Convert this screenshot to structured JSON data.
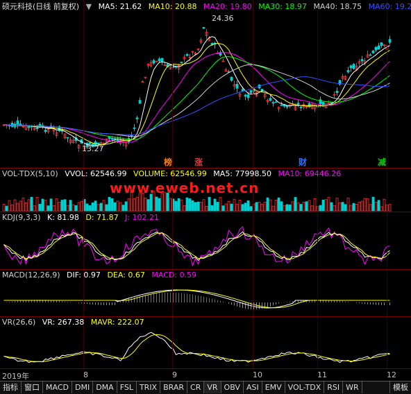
{
  "header": {
    "title": "硕元科技(日线 前复权)",
    "ma": [
      {
        "label": "MA5: 21.62",
        "color": "#ffffff"
      },
      {
        "label": "MA10: 20.88",
        "color": "#ffff00"
      },
      {
        "label": "MA20: 19.80",
        "color": "#ff00ff"
      },
      {
        "label": "MA30: 18.97",
        "color": "#00ff00"
      },
      {
        "label": "MA40: 18.75",
        "color": "#d0d0d0"
      },
      {
        "label": "MA60: 19.2",
        "color": "#3050ff"
      }
    ]
  },
  "price": {
    "high_label": "24.36",
    "low_label": "13.27"
  },
  "events": [
    {
      "label": "榜",
      "color": "#ff8000"
    },
    {
      "label": "涨",
      "color": "#ff3030"
    },
    {
      "label": "财",
      "color": "#3070ff"
    },
    {
      "label": "减",
      "color": "#00d000"
    }
  ],
  "volume_panel": {
    "legend": [
      {
        "label": "VOL-TDX(5,10)",
        "color": "#d0d0d0"
      },
      {
        "label": "VVOL: 62546.99",
        "color": "#ffffff"
      },
      {
        "label": "VOLUME: 62546.99",
        "color": "#ffff00"
      },
      {
        "label": "MA5: 77998.50",
        "color": "#ffffff"
      },
      {
        "label": "MA10: 69446.26",
        "color": "#ff00ff"
      }
    ],
    "watermark": "www.eweb.net.cn"
  },
  "kdj_panel": {
    "legend": [
      {
        "label": "KDJ(9,3,3)",
        "color": "#d0d0d0"
      },
      {
        "label": "K: 81.98",
        "color": "#ffffff"
      },
      {
        "label": "D: 71.87",
        "color": "#ffff00"
      },
      {
        "label": "J: 102.21",
        "color": "#ff00ff"
      }
    ]
  },
  "macd_panel": {
    "legend": [
      {
        "label": "MACD(12,26,9)",
        "color": "#d0d0d0"
      },
      {
        "label": "DIF: 0.97",
        "color": "#ffffff"
      },
      {
        "label": "DEA: 0.67",
        "color": "#ffff00"
      },
      {
        "label": "MACD: 0.59",
        "color": "#ff00ff"
      }
    ]
  },
  "vr_panel": {
    "legend": [
      {
        "label": "VR(26,6)",
        "color": "#d0d0d0"
      },
      {
        "label": "VR: 267.38",
        "color": "#ffffff"
      },
      {
        "label": "MAVR: 222.07",
        "color": "#ffff00"
      }
    ]
  },
  "xaxis": {
    "labels": [
      "2019年",
      "8",
      "9",
      "10",
      "11",
      "12"
    ]
  },
  "tabs": [
    "指标",
    "窗口",
    "MACD",
    "DMI",
    "DMA",
    "FSL",
    "TRIX",
    "BRAR",
    "CR",
    "VR",
    "OBV",
    "ASI",
    "EMV",
    "VOL-TDX",
    "RSI",
    "WR"
  ],
  "right_tab": "模板"
}
